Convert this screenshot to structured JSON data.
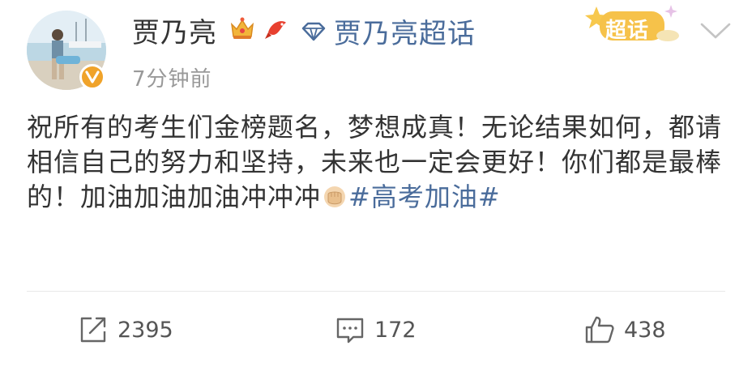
{
  "post": {
    "username": "贾乃亮",
    "timestamp": "7分钟前",
    "topic_link": "贾乃亮超话",
    "supertopic_button": "超话",
    "content_text": "祝所有的考生们金榜题名，梦想成真！无论结果如何，都请相信自己的努力和坚持，未来也一定会更好！你们都是最棒的！加油加油加油冲冲冲",
    "hashtag": "#高考加油#",
    "badges": [
      "crown-icon",
      "koi-fish-icon"
    ]
  },
  "actions": {
    "repost_count": "2395",
    "comment_count": "172",
    "like_count": "438"
  },
  "colors": {
    "link": "#4a6c9b",
    "text": "#333333",
    "muted": "#999999",
    "verified": "#f0a32a"
  }
}
